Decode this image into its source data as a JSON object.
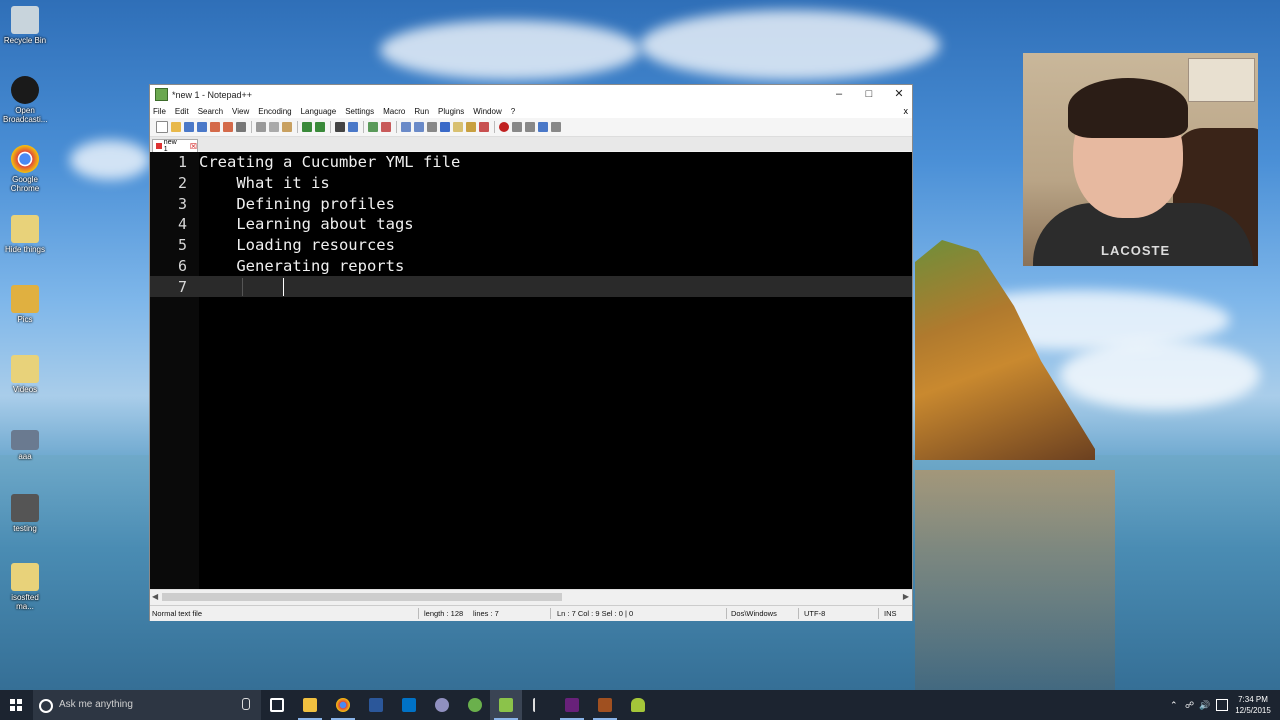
{
  "desktop": {
    "icons": [
      {
        "label": "Recycle Bin",
        "color": "#c8d4dc"
      },
      {
        "label": "Open Broadcasti...",
        "color": "#1a1a1a"
      },
      {
        "label": "Google Chrome",
        "color": "#e04a3a"
      },
      {
        "label": "Hide things",
        "color": "#e8d27a"
      },
      {
        "label": "Pics",
        "color": "#e0b040"
      },
      {
        "label": "Videos",
        "color": "#e8d27a"
      },
      {
        "label": "aaa",
        "color": "#6a7a90"
      },
      {
        "label": "testing",
        "color": "#555555"
      },
      {
        "label": "isosfted ma...",
        "color": "#e8d27a"
      }
    ]
  },
  "webcam": {
    "shirt_text": "LACOSTE"
  },
  "window": {
    "title": "*new 1 - Notepad++",
    "controls": {
      "minimize": "–",
      "maximize": "□",
      "close": "✕"
    },
    "menu": [
      "File",
      "Edit",
      "Search",
      "View",
      "Encoding",
      "Language",
      "Settings",
      "Macro",
      "Run",
      "Plugins",
      "Window",
      "?"
    ],
    "menu_close": "x",
    "tab": {
      "label": "new 1",
      "close": "☒"
    },
    "lines": [
      {
        "num": "1",
        "text": "Creating a Cucumber YML file"
      },
      {
        "num": "2",
        "text": "    What it is"
      },
      {
        "num": "3",
        "text": "    Defining profiles"
      },
      {
        "num": "4",
        "text": "    Learning about tags"
      },
      {
        "num": "5",
        "text": "    Loading resources"
      },
      {
        "num": "6",
        "text": "    Generating reports"
      },
      {
        "num": "7",
        "text": ""
      }
    ],
    "active_line": 7,
    "status": {
      "file_type": "Normal text file",
      "length": "length : 128",
      "lines": "lines : 7",
      "position": "Ln : 7    Col : 9    Sel : 0 | 0",
      "eol": "Dos\\Windows",
      "encoding": "UTF-8",
      "mode": "INS"
    }
  },
  "taskbar": {
    "search_placeholder": "Ask me anything",
    "apps": [
      {
        "name": "task-view",
        "color": "#ffffff"
      },
      {
        "name": "file-explorer",
        "color": "#f0c040"
      },
      {
        "name": "chrome",
        "color": "#e04a3a"
      },
      {
        "name": "word",
        "color": "#2b579a"
      },
      {
        "name": "outlook",
        "color": "#0072c6"
      },
      {
        "name": "app-bar",
        "color": "#9090c0"
      },
      {
        "name": "android-studio",
        "color": "#6ab04c"
      },
      {
        "name": "notepad-plus-plus",
        "color": "#8bc34a"
      },
      {
        "name": "app-arrow",
        "color": "#dddddd"
      },
      {
        "name": "visual-studio",
        "color": "#68217a"
      },
      {
        "name": "game-app",
        "color": "#a05020"
      },
      {
        "name": "android",
        "color": "#a4c639"
      }
    ],
    "time": "7:34 PM",
    "date": "12/5/2015"
  }
}
